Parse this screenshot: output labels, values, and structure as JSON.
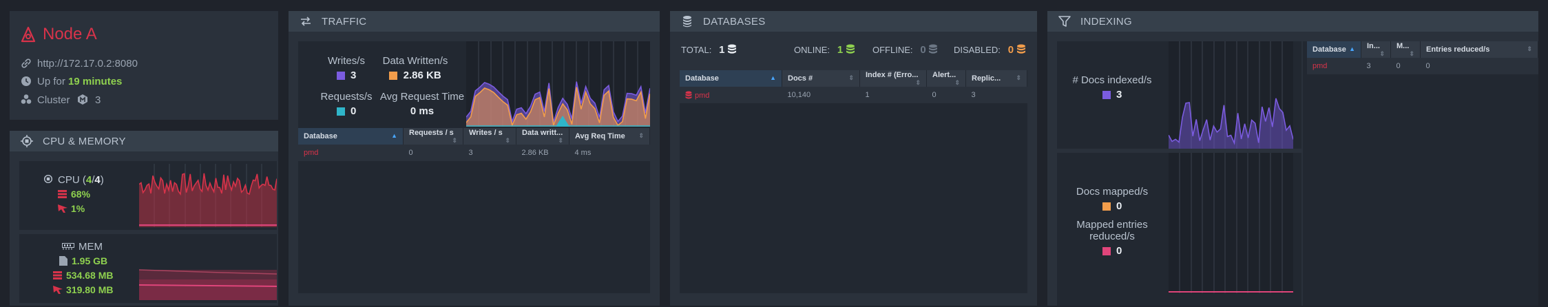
{
  "node": {
    "name": "Node A",
    "url": "http://172.17.0.2:8080",
    "uptime_prefix": "Up for",
    "uptime_value": "19 minutes",
    "cluster_label": "Cluster",
    "cluster_count": "3"
  },
  "cpu_memory": {
    "title": "CPU & MEMORY",
    "cpu_label": "CPU (",
    "cpu_cores_used": "4",
    "cpu_sep": "/",
    "cpu_cores_total": "4",
    "cpu_close": ")",
    "cpu_machine": "68%",
    "cpu_process": "1%",
    "mem_label": "MEM",
    "mem_total": "1.95 GB",
    "mem_machine": "534.68 MB",
    "mem_process": "319.80 MB",
    "cpu_machine_level": 0.68,
    "cpu_process_level": 0.01
  },
  "traffic": {
    "title": "TRAFFIC",
    "writes_label": "Writes/s",
    "writes_value": "3",
    "data_written_label": "Data Written/s",
    "data_written_value": "2.86 KB",
    "requests_label": "Requests/s",
    "requests_value": "0",
    "avg_req_label": "Avg Request Time",
    "avg_req_value": "0 ms",
    "columns": [
      "Database",
      "Requests / s",
      "Writes / s",
      "Data writt...",
      "Avg Req Time"
    ],
    "rows": [
      {
        "database": "pmd",
        "requests": "0",
        "writes": "3",
        "data_written": "2.86 KB",
        "avg_req_time": "4 ms"
      }
    ]
  },
  "databases": {
    "title": "DATABASES",
    "total_label": "TOTAL:",
    "total_value": "1",
    "online_label": "ONLINE:",
    "online_value": "1",
    "offline_label": "OFFLINE:",
    "offline_value": "0",
    "disabled_label": "DISABLED:",
    "disabled_value": "0",
    "columns": [
      "Database",
      "Docs #",
      "Index # (Erro...",
      "Alert...",
      "Replic..."
    ],
    "rows": [
      {
        "database": "pmd",
        "docs": "10,140",
        "indexes": "1",
        "alerts": "0",
        "replicas": "3"
      }
    ]
  },
  "indexing": {
    "title": "INDEXING",
    "docs_indexed_label": "# Docs indexed/s",
    "docs_indexed_value": "3",
    "docs_mapped_label": "Docs mapped/s",
    "docs_mapped_value": "0",
    "mapped_reduced_label": "Mapped entries reduced/s",
    "mapped_reduced_value": "0",
    "columns": [
      "Database",
      "In...",
      "M...",
      "Entries reduced/s"
    ],
    "rows": [
      {
        "database": "pmd",
        "indexed": "3",
        "mapped": "0",
        "reduced": "0"
      }
    ]
  },
  "colors": {
    "brand_red": "#d8334a",
    "green": "#8fd14f",
    "orange": "#f29d4b",
    "purple": "#7b5ce0",
    "teal": "#2fb5c9",
    "pink": "#e0457b"
  },
  "icons": [
    "node-icon",
    "link-icon",
    "clock-icon",
    "cluster-icon",
    "cpu-icon",
    "memory-icon",
    "traffic-icon",
    "database-stack-icon",
    "filter-icon"
  ]
}
